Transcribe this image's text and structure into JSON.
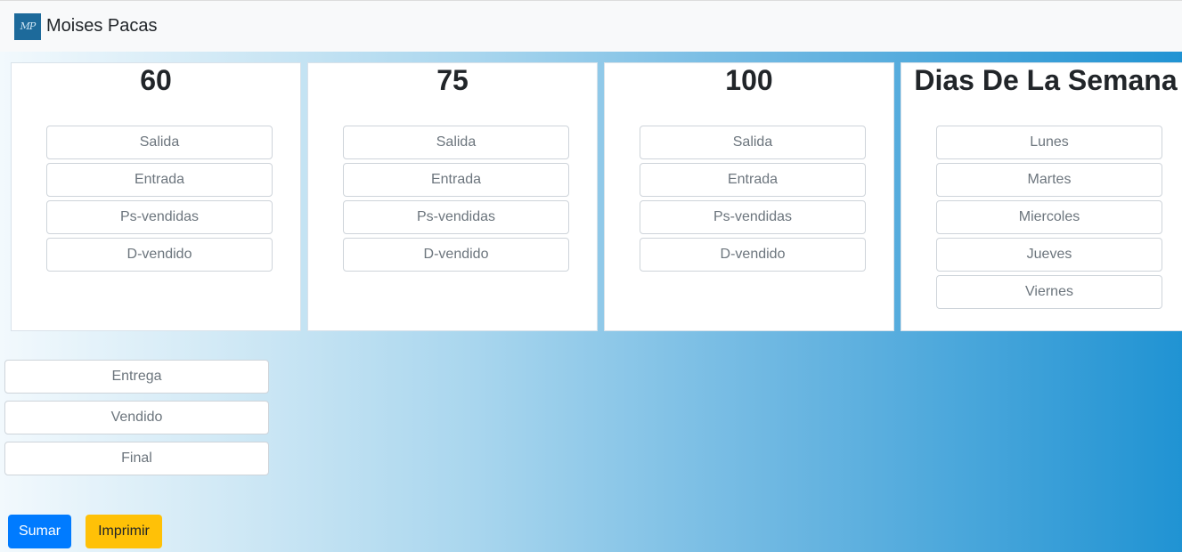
{
  "navbar": {
    "logo_text": "MP",
    "brand": "Moises Pacas"
  },
  "cards": [
    {
      "title": "60",
      "fields": [
        "Salida",
        "Entrada",
        "Ps-vendidas",
        "D-vendido"
      ]
    },
    {
      "title": "75",
      "fields": [
        "Salida",
        "Entrada",
        "Ps-vendidas",
        "D-vendido"
      ]
    },
    {
      "title": "100",
      "fields": [
        "Salida",
        "Entrada",
        "Ps-vendidas",
        "D-vendido"
      ]
    },
    {
      "title": "Dias De La Semana",
      "fields": [
        "Lunes",
        "Martes",
        "Miercoles",
        "Jueves",
        "Viernes"
      ]
    }
  ],
  "summary_fields": [
    "Entrega",
    "Vendido",
    "Final"
  ],
  "buttons": {
    "sumar": "Sumar",
    "imprimir": "Imprimir"
  },
  "colors": {
    "primary": "#007bff",
    "warning": "#ffc107",
    "gradient_end": "#2093d3"
  }
}
